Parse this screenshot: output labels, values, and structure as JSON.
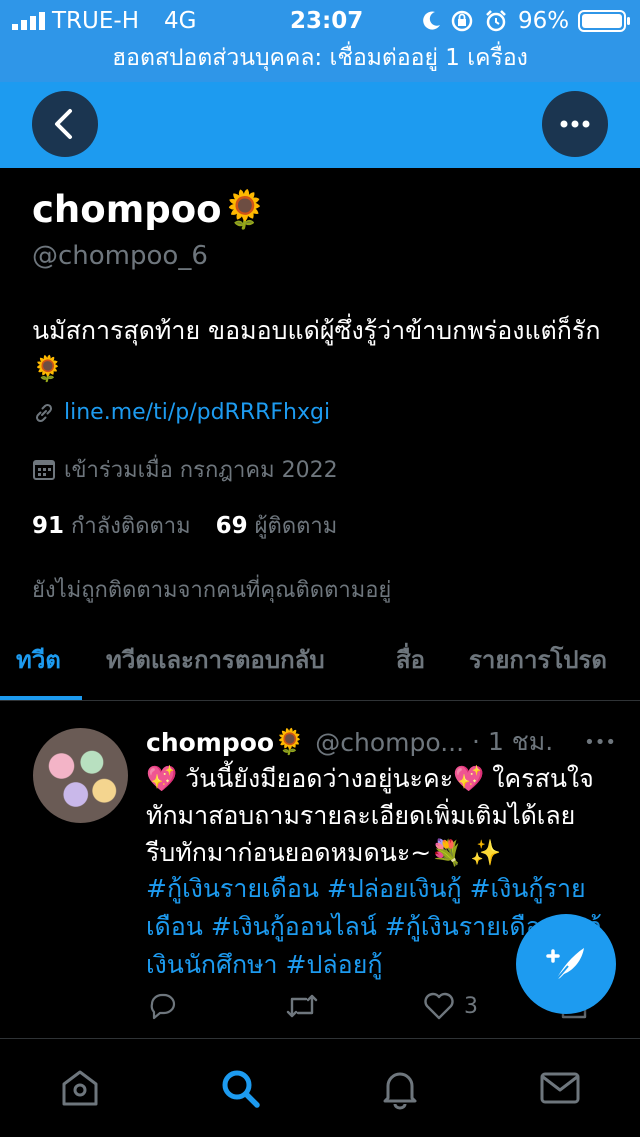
{
  "status_bar": {
    "carrier": "TRUE-H",
    "network": "4G",
    "time": "23:07",
    "battery": "96%",
    "hotspot_text": "ฮอตสปอตส่วนบุคคล: เชื่อมต่ออยู่ 1 เครื่อง"
  },
  "profile": {
    "name": "chompoo",
    "emoji": "🌻",
    "handle": "@chompoo_6",
    "bio": "นมัสการสุดท้าย ขอมอบแด่ผู้ซึ่งรู้ว่าข้าบกพร่องแต่ก็รัก",
    "link": "line.me/ti/p/pdRRRFhxgi",
    "joined": "เข้าร่วมเมื่อ กรกฎาคม 2022",
    "following_count": "91",
    "following_label": "กำลังติดตาม",
    "followers_count": "69",
    "followers_label": "ผู้ติดตาม",
    "not_followed_note": "ยังไม่ถูกติดตามจากคนที่คุณติดตามอยู่"
  },
  "tabs": [
    {
      "label": "ทวีต"
    },
    {
      "label": "ทวีตและการตอบกลับ"
    },
    {
      "label": "สื่อ"
    },
    {
      "label": "รายการโปรด"
    }
  ],
  "tweet": {
    "name": "chompoo",
    "emoji": "🌻",
    "handle": "@chompo...",
    "time": "· 1 ชม.",
    "more": "•••",
    "text": "💖 วันนี้ยังมียอดว่างอยู่นะคะ💖  ใครสนใจทักมาสอบถามรายละเอียดเพิ่มเติมได้เลย รีบทักมาก่อนยอดหมดนะ~💐 ✨",
    "hashtags": "#กู้เงินรายเดือน #ปล่อยเงินกู้  #เงินกู้รายเดือน  #เงินกู้ออนไลน์ #กู้เงินรายเดือน #กู้เงินนักศึกษา #ปล่อยกู้",
    "like_count": "3"
  },
  "icons": {
    "back": "back-arrow-icon",
    "more": "more-icon",
    "link": "link-icon",
    "calendar": "calendar-icon",
    "reply": "reply-icon",
    "retweet": "retweet-icon",
    "like": "heart-icon",
    "share": "share-icon",
    "compose": "compose-icon",
    "home": "home-icon",
    "search": "search-icon",
    "notifications": "bell-icon",
    "messages": "mail-icon"
  },
  "colors": {
    "accent": "#1d9bf0",
    "status_bar": "#2f96e8",
    "background": "#000000",
    "secondary_text": "#6e767d"
  }
}
